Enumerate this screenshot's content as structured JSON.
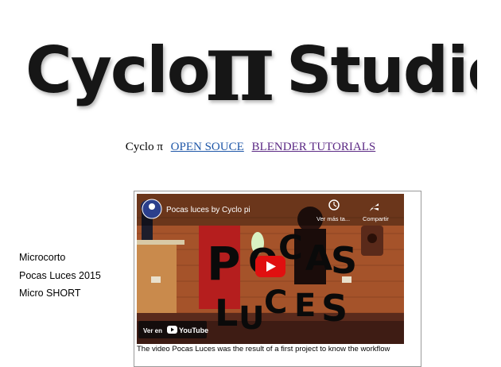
{
  "logo": {
    "left_text": "Cyclo",
    "symbol": "π",
    "right_text": "Studio"
  },
  "nav": {
    "brand": "Cyclo π",
    "links": [
      "OPEN SOUCE",
      "BLENDER TUTORIALS"
    ]
  },
  "sidebar": {
    "items": [
      "Microcorto",
      "Pocas Luces 2015",
      "Micro SHORT"
    ]
  },
  "video": {
    "title": "Pocas luces by Cyclo pi",
    "watch_later": "Ver más ta...",
    "share": "Compartir",
    "watch_on": "Ver en",
    "youtube": "YouTube",
    "poster_letters": [
      "P",
      "O",
      "C",
      "A",
      "S",
      "L",
      "U",
      "C",
      "E",
      "S"
    ]
  },
  "caption": "The video Pocas Luces was the result of a first project to know the workflow",
  "colors": {
    "link1": "#1f57a8",
    "link2": "#5c2a85",
    "play": "#e01010",
    "logo": "#141414"
  }
}
